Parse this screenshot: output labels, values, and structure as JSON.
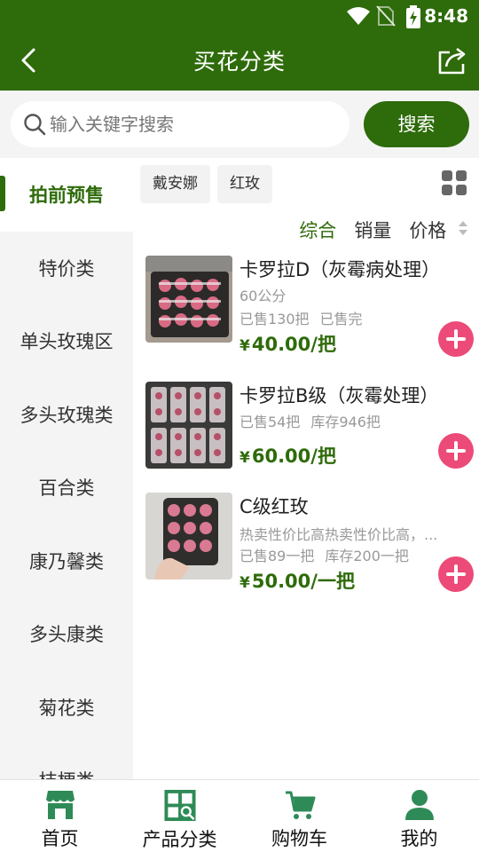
{
  "status": {
    "time": "8:48"
  },
  "header": {
    "title": "买花分类"
  },
  "search": {
    "placeholder": "输入关键字搜索",
    "button": "搜索"
  },
  "sidebar": {
    "items": [
      {
        "label": "拍前预售",
        "active": true
      },
      {
        "label": "特价类"
      },
      {
        "label": "单头玫瑰区"
      },
      {
        "label": "多头玫瑰类"
      },
      {
        "label": "百合类"
      },
      {
        "label": "康乃馨类"
      },
      {
        "label": "多头康类"
      },
      {
        "label": "菊花类"
      },
      {
        "label": "桔梗类"
      }
    ]
  },
  "tags": [
    "戴安娜",
    "红玫"
  ],
  "sort": {
    "items": [
      "综合",
      "销量",
      "价格"
    ],
    "active": "综合"
  },
  "products": [
    {
      "name": "卡罗拉D（灰霉病处理）",
      "spec": "60公分",
      "sold": "已售130把",
      "stock": "已售完",
      "price": "40.00/把",
      "currency": "¥"
    },
    {
      "name": "卡罗拉B级（灰霉处理）",
      "sold": "已售54把",
      "stock": "库存946把",
      "price": "60.00/把",
      "currency": "¥"
    },
    {
      "name": "C级红玫",
      "desc": "热卖性价比高热卖性价比高，...",
      "sold": "已售89一把",
      "stock": "库存200一把",
      "price": "50.00/一把",
      "currency": "¥"
    }
  ],
  "bottom_nav": [
    {
      "label": "首页",
      "icon": "store-icon"
    },
    {
      "label": "产品分类",
      "icon": "category-icon"
    },
    {
      "label": "购物车",
      "icon": "cart-icon"
    },
    {
      "label": "我的",
      "icon": "user-icon"
    }
  ],
  "colors": {
    "primary": "#2e6b0a",
    "accent": "#ec4a78",
    "background": "#f4f4f4"
  }
}
